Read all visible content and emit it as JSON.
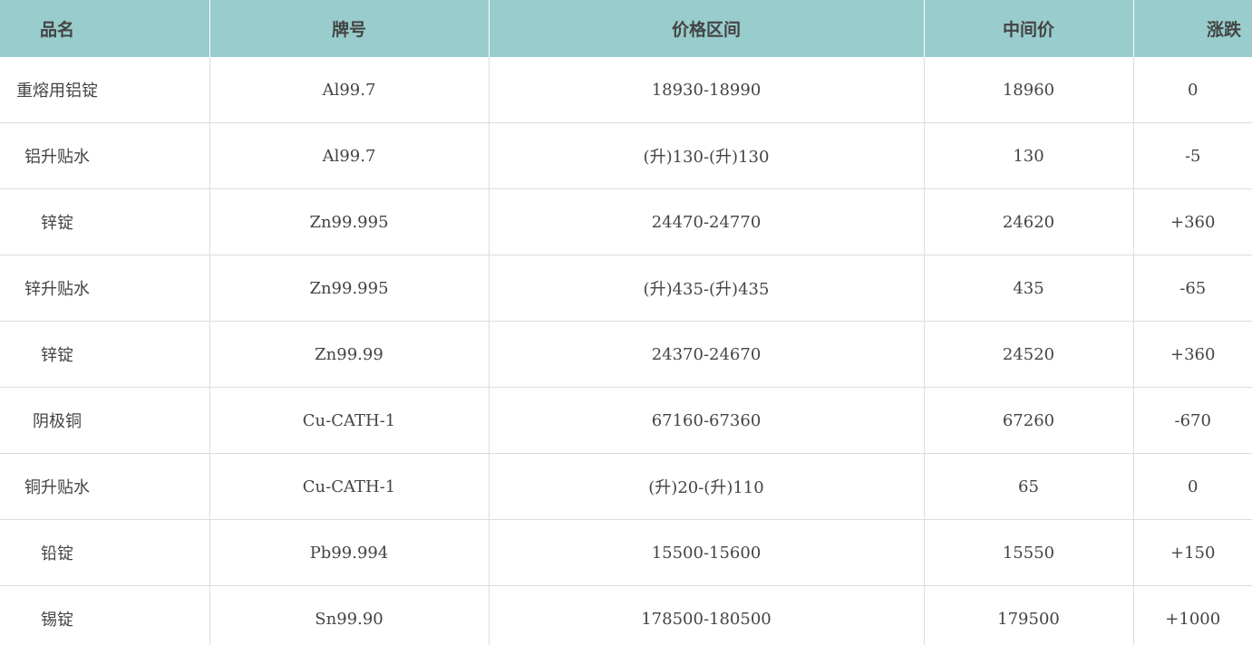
{
  "table": {
    "headers": {
      "name": "品名",
      "grade": "牌号",
      "price_range": "价格区间",
      "mid_price": "中间价",
      "change": "涨跌"
    },
    "rows": [
      {
        "name": "重熔用铝锭",
        "grade": "Al99.7",
        "price_range": "18930-18990",
        "mid_price": "18960",
        "change": "0"
      },
      {
        "name": "铝升贴水",
        "grade": "Al99.7",
        "price_range": "(升)130-(升)130",
        "mid_price": "130",
        "change": "-5"
      },
      {
        "name": "锌锭",
        "grade": "Zn99.995",
        "price_range": "24470-24770",
        "mid_price": "24620",
        "change": "+360"
      },
      {
        "name": "锌升贴水",
        "grade": "Zn99.995",
        "price_range": "(升)435-(升)435",
        "mid_price": "435",
        "change": "-65"
      },
      {
        "name": "锌锭",
        "grade": "Zn99.99",
        "price_range": "24370-24670",
        "mid_price": "24520",
        "change": "+360"
      },
      {
        "name": "阴极铜",
        "grade": "Cu-CATH-1",
        "price_range": "67160-67360",
        "mid_price": "67260",
        "change": "-670"
      },
      {
        "name": "铜升贴水",
        "grade": "Cu-CATH-1",
        "price_range": "(升)20-(升)110",
        "mid_price": "65",
        "change": "0"
      },
      {
        "name": "铅锭",
        "grade": "Pb99.994",
        "price_range": "15500-15600",
        "mid_price": "15550",
        "change": "+150"
      },
      {
        "name": "锡锭",
        "grade": "Sn99.90",
        "price_range": "178500-180500",
        "mid_price": "179500",
        "change": "+1000"
      }
    ]
  },
  "colors": {
    "header_bg": "#99cccc",
    "text": "#444444",
    "grid": "#dddddd"
  }
}
